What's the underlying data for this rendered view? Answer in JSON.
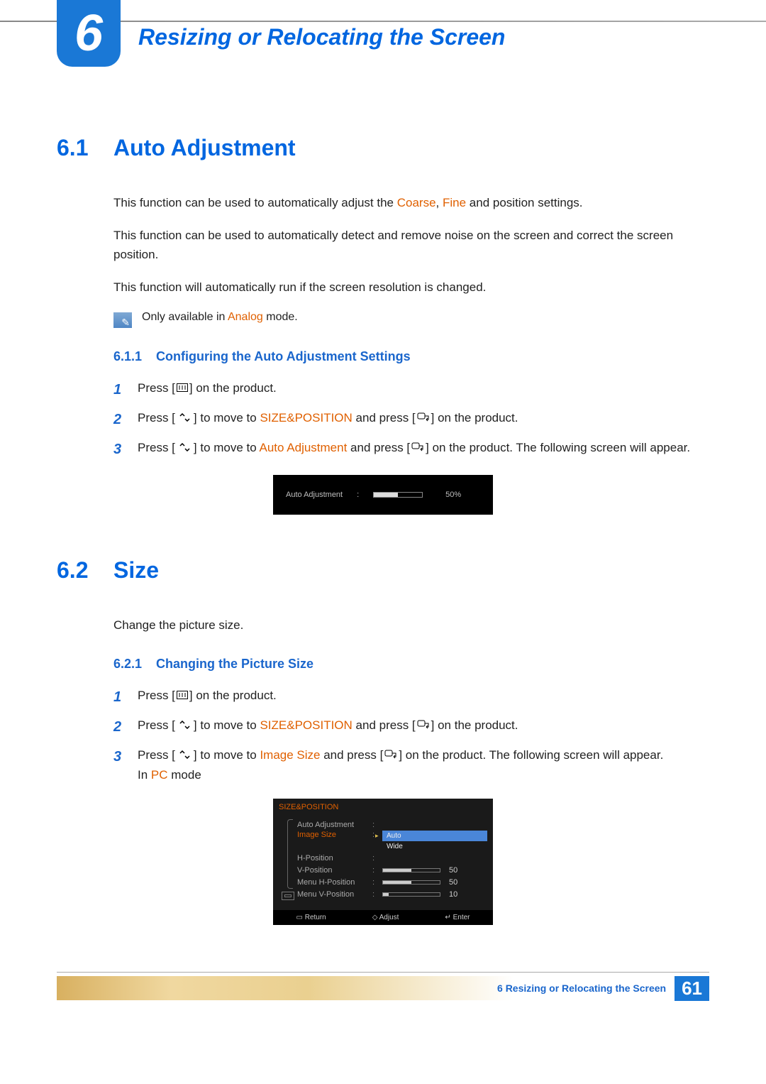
{
  "chapter": {
    "number": "6",
    "title": "Resizing or Relocating the Screen"
  },
  "sections": {
    "s61": {
      "num": "6.1",
      "title": "Auto Adjustment",
      "p1_a": "This function can be used to automatically adjust the ",
      "p1_coarse": "Coarse",
      "p1_sep": ", ",
      "p1_fine": "Fine",
      "p1_b": " and position settings.",
      "p2": "This function can be used to automatically detect and remove noise on the screen and correct the screen position.",
      "p3": "This function will automatically run if the screen resolution is changed.",
      "note_a": "Only available in ",
      "note_analog": "Analog",
      "note_b": " mode.",
      "sub": {
        "num": "6.1.1",
        "title": "Configuring the Auto Adjustment Settings"
      },
      "step1": {
        "a": "Press [",
        "b": "] on the product."
      },
      "step2": {
        "a": "Press [",
        "b": "] to move to ",
        "hl": "SIZE&POSITION",
        "c": " and press [",
        "d": "] on the product."
      },
      "step3": {
        "a": "Press [",
        "b": "] to move to ",
        "hl": "Auto Adjustment",
        "c": " and press [",
        "d": "] on the product. The following screen will appear."
      },
      "osd": {
        "label": "Auto Adjustment",
        "pct": "50%"
      }
    },
    "s62": {
      "num": "6.2",
      "title": "Size",
      "p1": "Change the picture size.",
      "sub": {
        "num": "6.2.1",
        "title": "Changing the Picture Size"
      },
      "step1": {
        "a": "Press [",
        "b": "] on the product."
      },
      "step2": {
        "a": "Press [",
        "b": "] to move to ",
        "hl": "SIZE&POSITION",
        "c": " and press [",
        "d": "] on the product."
      },
      "step3": {
        "a": "Press [",
        "b": "] to move to ",
        "hl": "Image Size",
        "c": " and press [",
        "d": "] on the product. The following screen will appear.",
        "mode_a": "In ",
        "mode_hl": "PC",
        "mode_b": " mode"
      },
      "menu": {
        "title": "SIZE&POSITION",
        "rows": {
          "r0": {
            "name": "Auto Adjustment",
            "val": ""
          },
          "r1": {
            "name": "Image Size",
            "opts": {
              "o0": "Auto",
              "o1": "Wide"
            }
          },
          "r2": {
            "name": "H-Position",
            "val": ""
          },
          "r3": {
            "name": "V-Position",
            "val": "50",
            "fill": 50
          },
          "r4": {
            "name": "Menu H-Position",
            "val": "50",
            "fill": 50
          },
          "r5": {
            "name": "Menu V-Position",
            "val": "10",
            "fill": 10
          }
        },
        "footer": {
          "f0": "Return",
          "f1": "Adjust",
          "f2": "Enter"
        }
      }
    }
  },
  "footer": {
    "text": "6 Resizing or Relocating the Screen",
    "page": "61"
  }
}
